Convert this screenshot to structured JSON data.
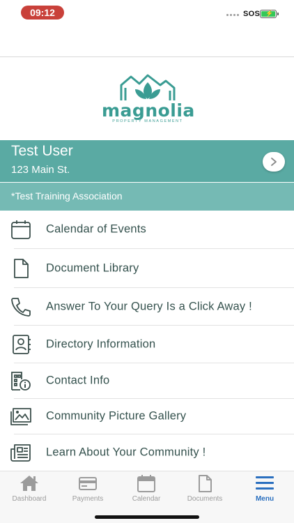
{
  "status_bar": {
    "time": "09:12",
    "carrier": "SOS"
  },
  "logo": {
    "word": "magnolia",
    "sub": "PROPERTY MANAGEMENT"
  },
  "user": {
    "name": "Test User",
    "address": "123 Main St.",
    "association": "*Test Training Association"
  },
  "menu": {
    "items": [
      {
        "label": "Calendar of Events",
        "icon": "calendar-icon"
      },
      {
        "label": "Document Library",
        "icon": "document-icon"
      },
      {
        "label": "Answer To Your Query Is a Click Away !",
        "icon": "phone-icon"
      },
      {
        "label": "Directory Information",
        "icon": "contact-book-icon"
      },
      {
        "label": "Contact Info",
        "icon": "building-info-icon"
      },
      {
        "label": "Community Picture Gallery",
        "icon": "gallery-icon"
      },
      {
        "label": "Learn About Your Community !",
        "icon": "newspaper-icon"
      }
    ]
  },
  "tabs": [
    {
      "label": "Dashboard",
      "icon": "home-icon"
    },
    {
      "label": "Payments",
      "icon": "credit-card-icon"
    },
    {
      "label": "Calendar",
      "icon": "calendar-icon"
    },
    {
      "label": "Documents",
      "icon": "document-icon"
    },
    {
      "label": "Menu",
      "icon": "hamburger-menu-icon",
      "active": true
    }
  ],
  "colors": {
    "teal": "#5aaaa3",
    "teal_light": "#75bab4",
    "text": "#35524e",
    "tab_active": "#2a6fbf",
    "tab_inactive": "#9b9b9b"
  }
}
